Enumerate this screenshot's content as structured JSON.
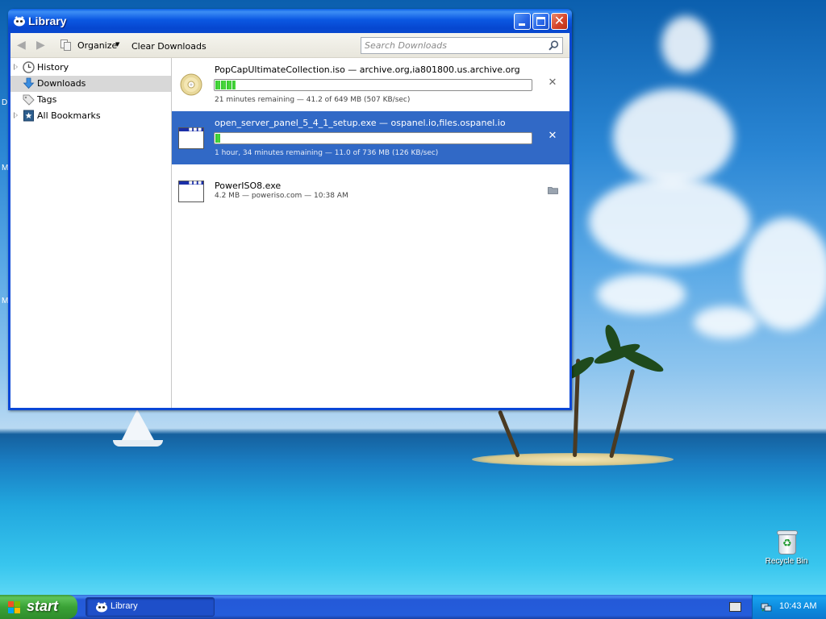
{
  "desktop": {
    "edge_letters": [
      "D",
      "M",
      "M"
    ],
    "recycle_bin_label": "Recycle Bin"
  },
  "window": {
    "title": "Library",
    "toolbar": {
      "organize_label": "Organize",
      "clear_downloads_label": "Clear Downloads",
      "search_placeholder": "Search Downloads"
    },
    "sidebar": {
      "items": [
        {
          "label": "History",
          "icon": "clock-icon",
          "expandable": true,
          "selected": false
        },
        {
          "label": "Downloads",
          "icon": "download-arrow-icon",
          "expandable": false,
          "selected": true
        },
        {
          "label": "Tags",
          "icon": "tag-icon",
          "expandable": false,
          "selected": false
        },
        {
          "label": "All Bookmarks",
          "icon": "bookmarks-icon",
          "expandable": true,
          "selected": false
        }
      ]
    },
    "downloads": [
      {
        "name": "PopCapUltimateCollection.iso — archive.org,ia801800.us.archive.org",
        "status": "21 minutes remaining — 41.2 of 649 MB (507 KB/sec)",
        "progress_fraction": 0.063,
        "file_icon": "disc-icon",
        "state": "in-progress",
        "selected": false
      },
      {
        "name": "open_server_panel_5_4_1_setup.exe — ospanel.io,files.ospanel.io",
        "status": "1 hour, 34 minutes remaining — 11.0 of 736 MB (126 KB/sec)",
        "progress_fraction": 0.015,
        "file_icon": "application-window-icon",
        "state": "in-progress",
        "selected": true
      },
      {
        "name": "PowerISO8.exe",
        "status": "4.2 MB — poweriso.com — 10:38 AM",
        "file_icon": "application-window-icon",
        "state": "done",
        "selected": false
      }
    ]
  },
  "taskbar": {
    "start_label": "start",
    "tasks": [
      {
        "label": "Library"
      }
    ],
    "clock": "10:43 AM"
  },
  "colors": {
    "selection": "#3169c6",
    "progress_green": "#31c42f",
    "titlebar_blue": "#0a47d6",
    "start_green": "#3aa236",
    "tray_blue": "#0d8ade"
  }
}
